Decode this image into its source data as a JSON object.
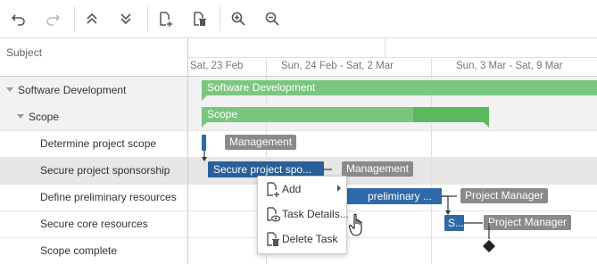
{
  "toolbar": {
    "buttons": [
      {
        "name": "undo",
        "icon": "undo-icon"
      },
      {
        "name": "redo",
        "icon": "redo-icon"
      },
      {
        "name": "collapse-all",
        "icon": "chevron-double-up-icon"
      },
      {
        "name": "expand-all",
        "icon": "chevron-double-down-icon"
      },
      {
        "name": "add-task",
        "icon": "add-task-icon"
      },
      {
        "name": "delete-task",
        "icon": "delete-task-icon"
      },
      {
        "name": "zoom-in",
        "icon": "zoom-in-icon"
      },
      {
        "name": "zoom-out",
        "icon": "zoom-out-icon"
      }
    ]
  },
  "grid": {
    "header": "Subject",
    "rows": [
      {
        "label": "Software Development",
        "level": 0,
        "expandable": true
      },
      {
        "label": "Scope",
        "level": 1,
        "expandable": true
      },
      {
        "label": "Determine project scope",
        "level": 2
      },
      {
        "label": "Secure project sponsorship",
        "level": 2,
        "selected": true
      },
      {
        "label": "Define preliminary resources",
        "level": 2
      },
      {
        "label": "Secure core resources",
        "level": 2
      },
      {
        "label": "Scope complete",
        "level": 2
      }
    ]
  },
  "timeline": {
    "scales": [
      "Sat, 23 Feb",
      "Sun, 24 Feb - Sat, 2 Mar",
      "Sun, 3 Mar - Sat, 9 Mar"
    ]
  },
  "bars": {
    "software_development": "Software Development",
    "scope": "Scope",
    "secure_sponsorship": "Secure project spo...",
    "define_resources": "preliminary ...",
    "secure_core": "S..."
  },
  "resources": {
    "r1": "Management",
    "r2": "Management",
    "r3": "Project Manager",
    "r4": "Project Manager"
  },
  "context_menu": {
    "items": [
      {
        "label": "Add",
        "icon": "add-icon",
        "submenu": true
      },
      {
        "label": "Task Details...",
        "icon": "task-details-icon"
      },
      {
        "label": "Delete Task",
        "icon": "delete-icon"
      }
    ]
  },
  "colors": {
    "summary": "#7bc67e",
    "task": "#2e6aa8",
    "resource": "#8a8a8a",
    "selected_row": "#e6e6e6"
  }
}
